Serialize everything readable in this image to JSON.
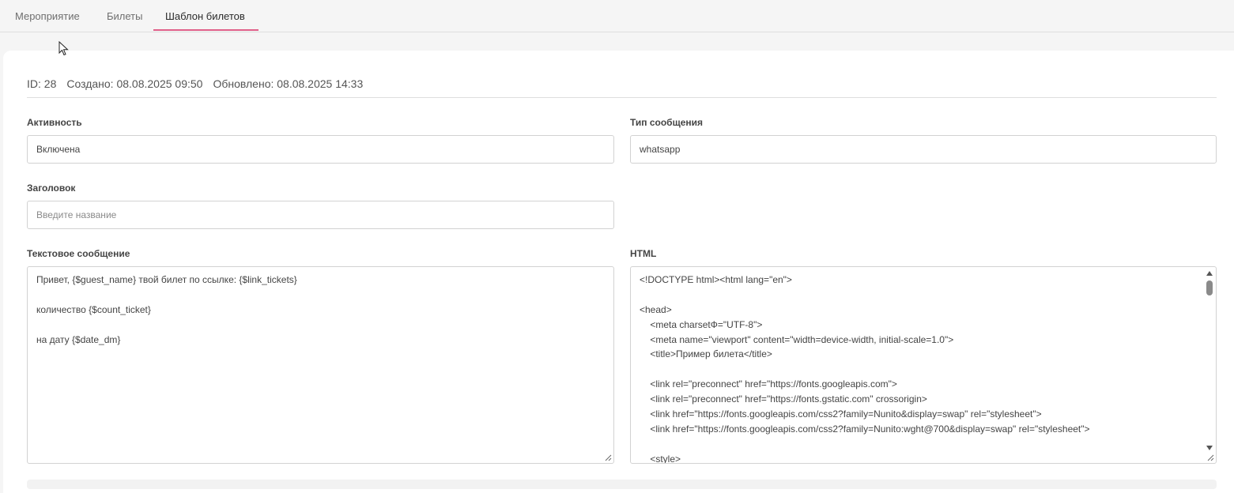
{
  "tabs": [
    {
      "label": "Мероприятие"
    },
    {
      "label": "Билеты"
    },
    {
      "label": "Шаблон билетов"
    }
  ],
  "meta": {
    "id": "ID: 28",
    "created": "Создано: 08.08.2025 09:50",
    "updated": "Обновлено: 08.08.2025 14:33"
  },
  "form": {
    "active_label": "Активность",
    "active_value": "Включена",
    "type_label": "Тип сообщения",
    "type_value": "whatsapp",
    "title_label": "Заголовок",
    "title_placeholder": "Введите название",
    "text_label": "Текстовое сообщение",
    "text_lines": [
      "Привет, {$guest_name} твой билет по ссылке: {$link_tickets}",
      "",
      "количество {$count_ticket}",
      "",
      "на дату {$date_dm}"
    ],
    "html_label": "HTML",
    "html_lines": [
      "<!DOCTYPE html><html lang=\"en\">",
      "",
      "<head>",
      "    <meta charsetФ=\"UTF-8\">",
      "    <meta name=\"viewport\" content=\"width=device-width, initial-scale=1.0\">",
      "    <title>Пример билета</title>",
      "",
      "    <link rel=\"preconnect\" href=\"https://fonts.googleapis.com\">",
      "    <link rel=\"preconnect\" href=\"https://fonts.gstatic.com\" crossorigin>",
      "    <link href=\"https://fonts.googleapis.com/css2?family=Nunito&display=swap\" rel=\"stylesheet\">",
      "    <link href=\"https://fonts.googleapis.com/css2?family=Nunito:wght@700&display=swap\" rel=\"stylesheet\">",
      "",
      "    <style>"
    ]
  },
  "colors": {
    "tab_underline": "#e0608a",
    "background": "#f5f5f5",
    "card": "#ffffff"
  }
}
